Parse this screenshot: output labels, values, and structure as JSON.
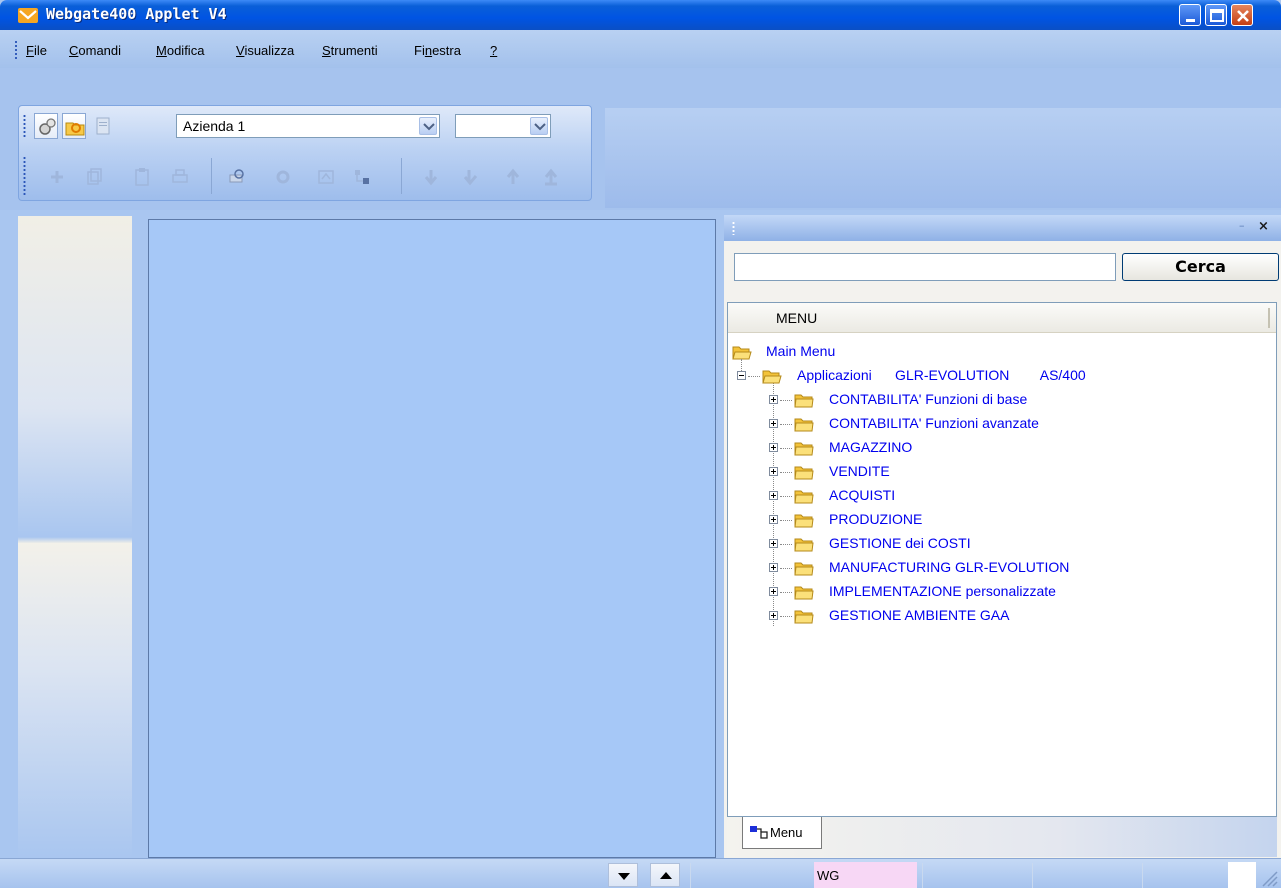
{
  "window": {
    "title": "Webgate400 Applet V4"
  },
  "menubar": {
    "items": [
      {
        "label": "File",
        "mnemonic": "F",
        "rest": "ile"
      },
      {
        "label": "Comandi",
        "mnemonic": "C",
        "rest": "omandi"
      },
      {
        "label": "Modifica",
        "mnemonic": "M",
        "rest": "odifica"
      },
      {
        "label": "Visualizza",
        "mnemonic": "V",
        "rest": "isualizza"
      },
      {
        "label": "Strumenti",
        "mnemonic": "S",
        "rest": "trumenti"
      },
      {
        "label": "Finestra",
        "pre": "Fi",
        "mnemonic": "n",
        "rest": "estra"
      },
      {
        "label": "?",
        "mnemonic": "?",
        "rest": ""
      }
    ]
  },
  "toolbar": {
    "company_value": "Azienda 1",
    "second_value": ""
  },
  "search": {
    "value": "",
    "button_label": "Cerca"
  },
  "tree": {
    "header": "MENU",
    "root": "Main Menu",
    "applications": "Applicazioni      GLR-EVOLUTION        AS/400",
    "items": [
      "CONTABILITA' Funzioni di base",
      "CONTABILITA' Funzioni avanzate",
      "MAGAZZINO",
      "VENDITE",
      "ACQUISTI",
      "PRODUZIONE",
      "GESTIONE dei COSTI",
      "MANUFACTURING GLR-EVOLUTION",
      "IMPLEMENTAZIONE personalizzate",
      "GESTIONE AMBIENTE GAA"
    ]
  },
  "dock": {
    "tab_label": "Menu"
  },
  "statusbar": {
    "wg_label": "WG"
  },
  "colors": {
    "titlebar": "#0054e3",
    "desktop": "#a6c8f7",
    "tree_link": "#0000ee",
    "status_wg": "#f7d7f5"
  }
}
